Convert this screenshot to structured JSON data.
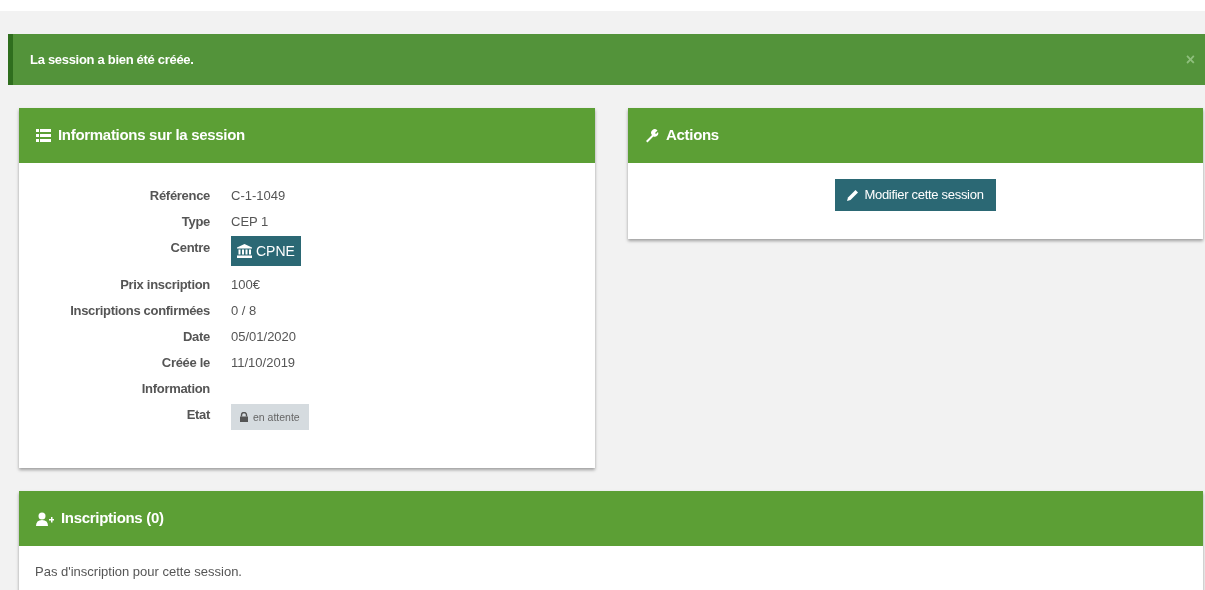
{
  "alert": {
    "message": "La session a bien été créée.",
    "close": "×"
  },
  "info_panel": {
    "title": "Informations sur la session",
    "fields": [
      {
        "label": "Référence",
        "value": "C-1-1049",
        "kind": "text"
      },
      {
        "label": "Type",
        "value": "CEP 1",
        "kind": "text"
      },
      {
        "label": "Centre",
        "value": "CPNE",
        "kind": "badge"
      },
      {
        "label": "Prix inscription",
        "value": "100€",
        "kind": "text"
      },
      {
        "label": "Inscriptions confirmées",
        "value": "0 / 8",
        "kind": "text"
      },
      {
        "label": "Date",
        "value": "05/01/2020",
        "kind": "text"
      },
      {
        "label": "Créée le",
        "value": "11/10/2019",
        "kind": "text"
      },
      {
        "label": "Information",
        "kind": "text"
      },
      {
        "label": "Etat",
        "value": "en attente",
        "kind": "status"
      }
    ]
  },
  "actions_panel": {
    "title": "Actions",
    "buttons": [
      "Modifier cette session"
    ]
  },
  "inscriptions_panel": {
    "title": "Inscriptions (0)",
    "empty_message": "Pas d'inscription pour cette session."
  }
}
